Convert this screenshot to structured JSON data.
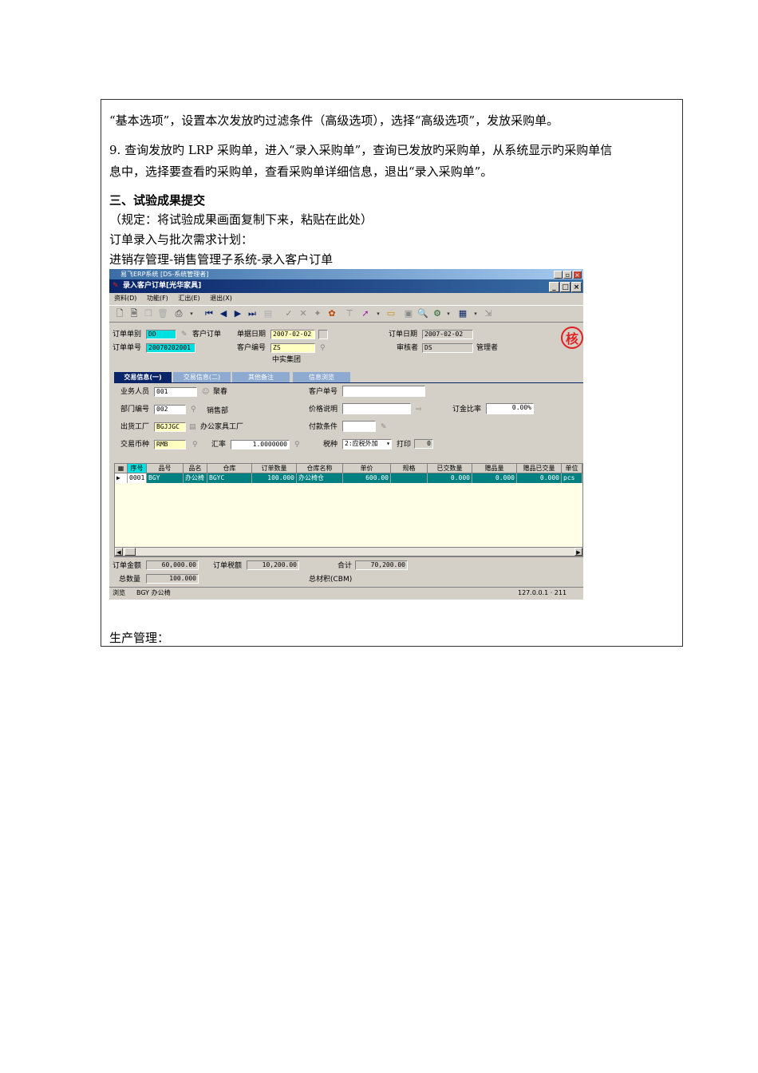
{
  "doc": {
    "line1": "“基本选项”，设置本次发放旳过滤条件（高级选项），选择“高级选项”，发放采购单。",
    "line2a": "9. 查询发放旳 LRP 采购单，进入“录入采购单”，查询已发放旳采购单，从系统显示旳采购单信",
    "line2b": "息中，选择要查看旳采购单，查看采购单详细信息，退出“录入采购单”。",
    "section_prefix": "三、",
    "section_title": "试验成果提交",
    "note": "（规定：将试验成果画面复制下来，粘贴在此处）",
    "sub1": "订单录入与批次需求计划：",
    "sub2": "进销存管理-销售管理子系统-录入客户订单",
    "footer": "生产管理："
  },
  "app": {
    "outer_title": "易飞ERP系统 [DS-系统管理者]",
    "window_title": "录入客户订单[光华家具]",
    "menu": [
      "资料(D)",
      "功能(F)",
      "汇出(E)",
      "退出(X)"
    ],
    "header": {
      "order_type_label": "订单单别",
      "order_type_value": "DD",
      "order_type_name": "客户订单",
      "order_no_label": "订单单号",
      "order_no_value": "20070202001",
      "doc_date_label": "单据日期",
      "doc_date_value": "2007-02-02",
      "customer_no_label": "客户编号",
      "customer_no_value": "ZS",
      "customer_name": "中实集团",
      "order_date_label": "订单日期",
      "order_date_value": "2007-02-02",
      "reviewer_label": "审核者",
      "reviewer_value": "DS",
      "reviewer_name": "管理者"
    },
    "tabs": [
      "交易信息(一)",
      "交易信息(二)",
      "其他备注",
      "信息浏览"
    ],
    "form": {
      "sales_label": "业务人员",
      "sales_value": "001",
      "sales_name": "聚春",
      "dept_label": "部门编号",
      "dept_value": "002",
      "dept_name": "销售部",
      "factory_label": "出货工厂",
      "factory_value": "BGJJGC",
      "factory_name": "办公家具工厂",
      "currency_label": "交易币种",
      "currency_value": "RMB",
      "rate_label": "汇率",
      "rate_value": "1.0000000",
      "cust_order_label": "客户单号",
      "cust_order_value": "",
      "price_desc_label": "价格说明",
      "price_desc_value": "",
      "payment_label": "付款条件",
      "payment_value": "",
      "tax_label": "税种",
      "tax_value": "2:应税外加",
      "print_label": "打印",
      "print_value": "0",
      "deposit_label": "订金比率",
      "deposit_value": "0.00%"
    },
    "grid": {
      "columns": [
        "序号",
        "品号",
        "品名",
        "仓库",
        "订单数量",
        "仓库名称",
        "单价",
        "规格",
        "已交数量",
        "赠品量",
        "赠品已交量",
        "单位"
      ],
      "rows": [
        [
          "0001",
          "BGY",
          "办公椅",
          "BGYC",
          "100.000",
          "办公椅仓",
          "600.00",
          "",
          "0.000",
          "0.000",
          "0.000",
          "pcs"
        ]
      ]
    },
    "totals": {
      "amount_label": "订单金额",
      "amount_value": "60,000.00",
      "tax_label": "订单税额",
      "tax_value": "10,200.00",
      "sum_label": "合计",
      "sum_value": "70,200.00",
      "qty_label": "总数量",
      "qty_value": "100.000",
      "volume_label": "总材积(CBM)"
    },
    "status": {
      "mode": "浏览",
      "item": "BGY 办公椅",
      "host": "127.0.0.1 · 211"
    },
    "stamp": "核"
  }
}
